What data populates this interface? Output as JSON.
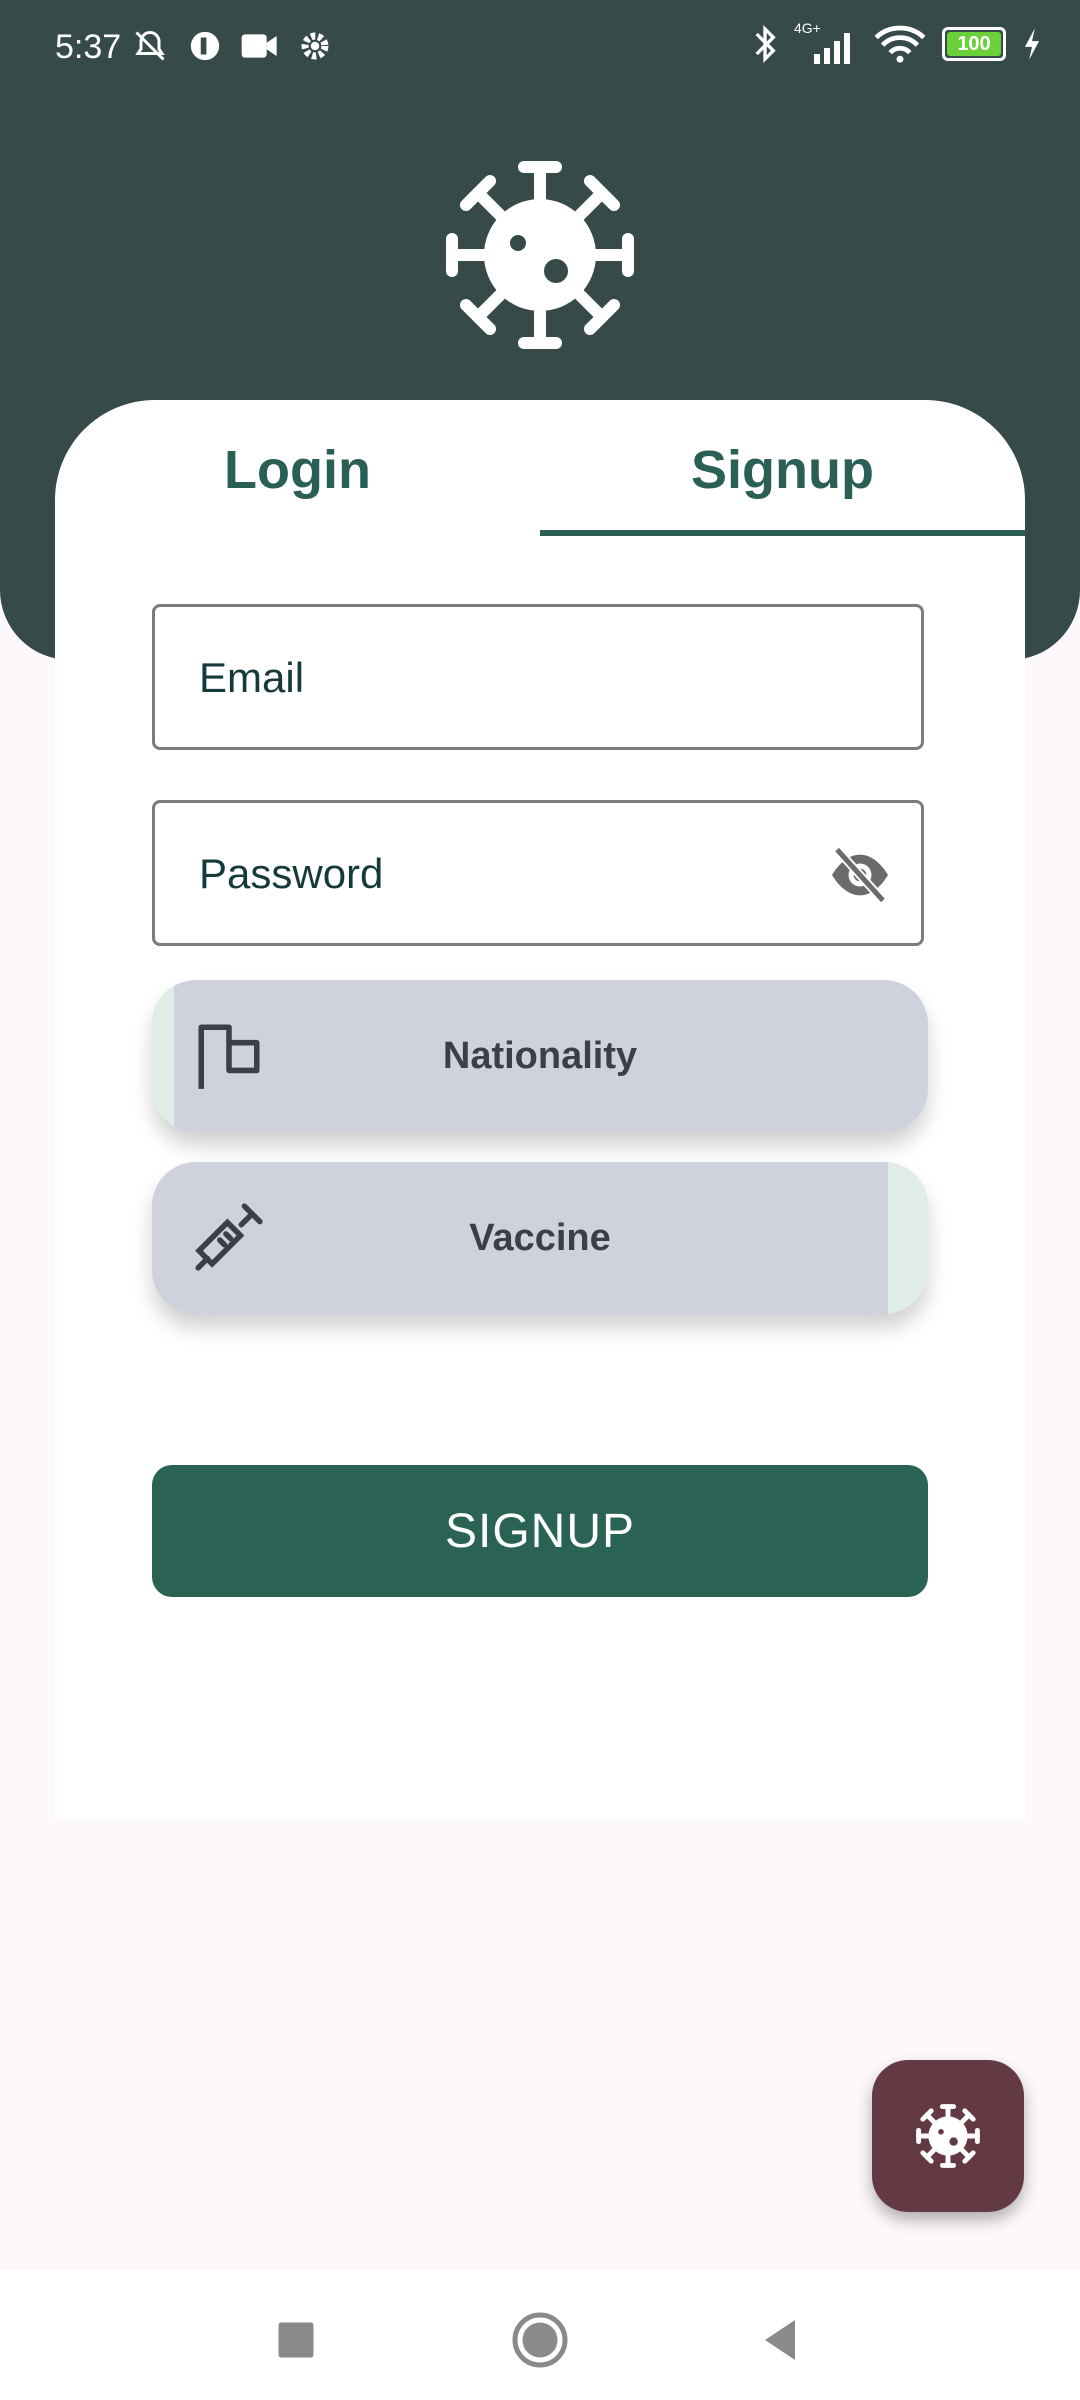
{
  "status_bar": {
    "time": "5:37",
    "battery": "100",
    "network": "4G+"
  },
  "auth": {
    "tabs": [
      {
        "label": "Login",
        "selected": false
      },
      {
        "label": "Signup",
        "selected": true
      }
    ],
    "email_placeholder": "Email",
    "password_placeholder": "Password",
    "nationality_label": "Nationality",
    "vaccine_label": "Vaccine",
    "submit_label": "SIGNUP"
  },
  "icons": {
    "logo": "virus-icon",
    "fab": "virus-icon",
    "password_toggle": "eye-off-icon",
    "nationality": "flag-icon",
    "vaccine": "syringe-icon"
  },
  "colors": {
    "header": "#374a4a",
    "accent": "#2a5f55",
    "button": "#2a6354",
    "fab": "#633a43",
    "pill": "#cfd2dc"
  }
}
